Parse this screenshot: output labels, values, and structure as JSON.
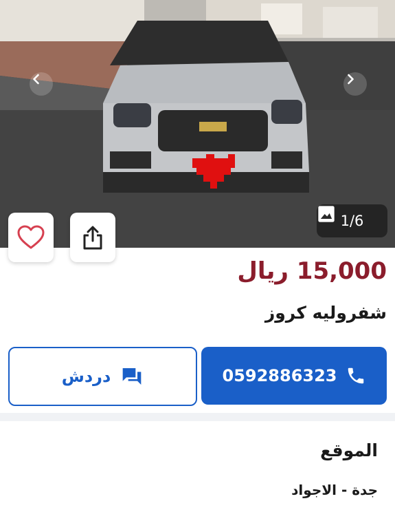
{
  "gallery": {
    "counter": "1/6",
    "prev_icon": "chevron-left-icon",
    "next_icon": "chevron-right-icon",
    "image_icon": "image-icon"
  },
  "actions": {
    "favorite_icon": "heart-icon",
    "share_icon": "share-icon"
  },
  "listing": {
    "price": "15,000 ريال",
    "title": "شفروليه كروز"
  },
  "contact": {
    "phone": "0592886323",
    "chat_label": "دردش"
  },
  "location": {
    "heading": "الموقع",
    "value": "جدة - الاجواد"
  },
  "colors": {
    "price": "#8b1d2c",
    "primary": "#1a5fc8"
  }
}
